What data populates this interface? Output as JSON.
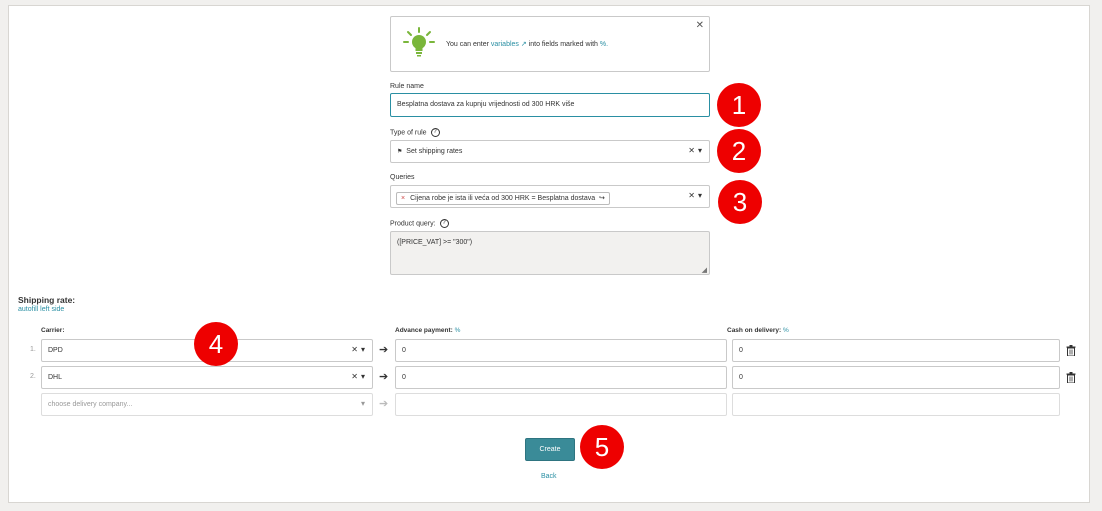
{
  "info": {
    "prefix": "You can enter",
    "link": "variables",
    "link_icon": "↗",
    "suffix": "into fields marked with",
    "marker": "%."
  },
  "rule_name": {
    "label": "Rule name",
    "value": "Besplatna dostava za kupnju vrijednosti od 300 HRK više"
  },
  "type_of_rule": {
    "label": "Type of rule",
    "value": "Set shipping rates"
  },
  "queries": {
    "label": "Queries",
    "tag": "Cijena robe je ista ili veća od 300 HRK = Besplatna dostava"
  },
  "product_query": {
    "label": "Product query:",
    "value": "([PRICE_VAT] >= \"300\")"
  },
  "shipping": {
    "title": "Shipping rate:",
    "autofill": "autofill left side",
    "headers": {
      "carrier": "Carrier:",
      "advance": "Advance payment:",
      "cod": "Cash on delivery:",
      "pct": "%"
    },
    "rows": [
      {
        "num": "1.",
        "carrier": "DPD",
        "advance": "0",
        "cod": "0"
      },
      {
        "num": "2.",
        "carrier": "DHL",
        "advance": "0",
        "cod": "0"
      }
    ],
    "new_placeholder": "choose delivery company..."
  },
  "actions": {
    "create": "Create",
    "back": "Back"
  },
  "badges": [
    "1",
    "2",
    "3",
    "4",
    "5"
  ],
  "colors": {
    "accent": "#2a8fa3",
    "button": "#3a8b98",
    "badge": "#ee0000"
  }
}
